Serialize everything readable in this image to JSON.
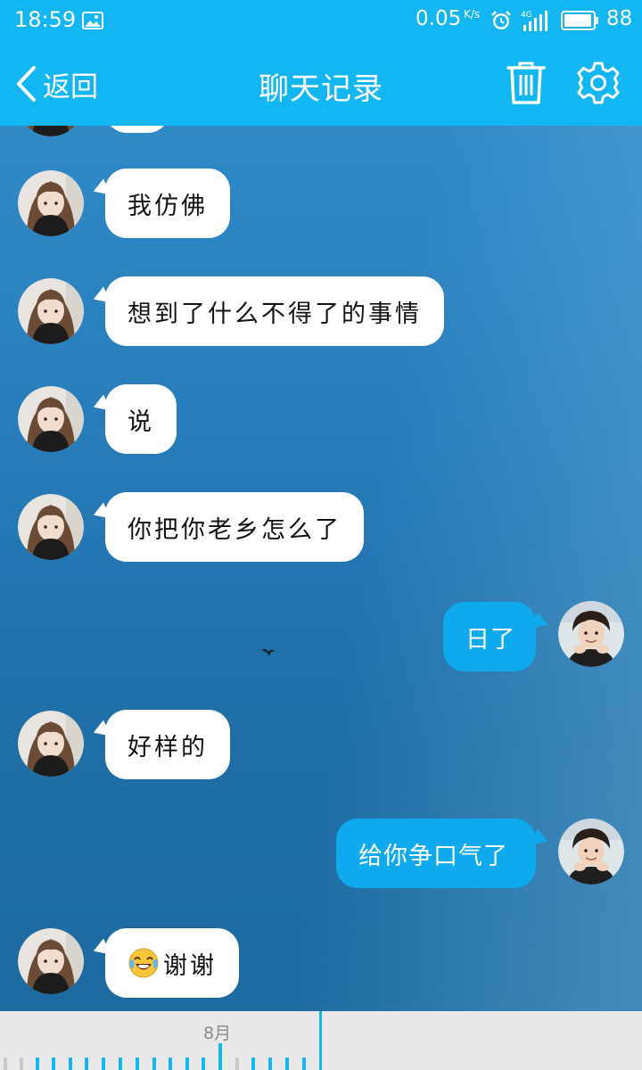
{
  "status_bar": {
    "time": "18:59",
    "network_speed": "0.05",
    "speed_unit": "K/s",
    "network_type": "4G",
    "battery_level": "88",
    "icons": [
      "gallery-icon",
      "alarm-icon",
      "signal-icon",
      "battery-icon"
    ]
  },
  "header": {
    "back_label": "返回",
    "title": "聊天记录",
    "icons": [
      "chevron-left-icon",
      "trash-icon",
      "gear-icon"
    ]
  },
  "colors": {
    "header_background": "#12b6f2",
    "outgoing_bubble": "#0fa9ee",
    "incoming_bubble": "#ffffff",
    "timeline_accent": "#12b6f2"
  },
  "messages": [
    {
      "sender": "other",
      "text": "我仿佛"
    },
    {
      "sender": "other",
      "text": "想到了什么不得了的事情"
    },
    {
      "sender": "other",
      "text": "说"
    },
    {
      "sender": "other",
      "text": "你把你老乡怎么了"
    },
    {
      "sender": "me",
      "text": "日了"
    },
    {
      "sender": "other",
      "text": "好样的"
    },
    {
      "sender": "me",
      "text": "给你争口气了"
    },
    {
      "sender": "other",
      "emoji": "tears-of-joy-emoji",
      "text": "谢谢"
    }
  ],
  "timeline": {
    "month_label": "8月"
  }
}
